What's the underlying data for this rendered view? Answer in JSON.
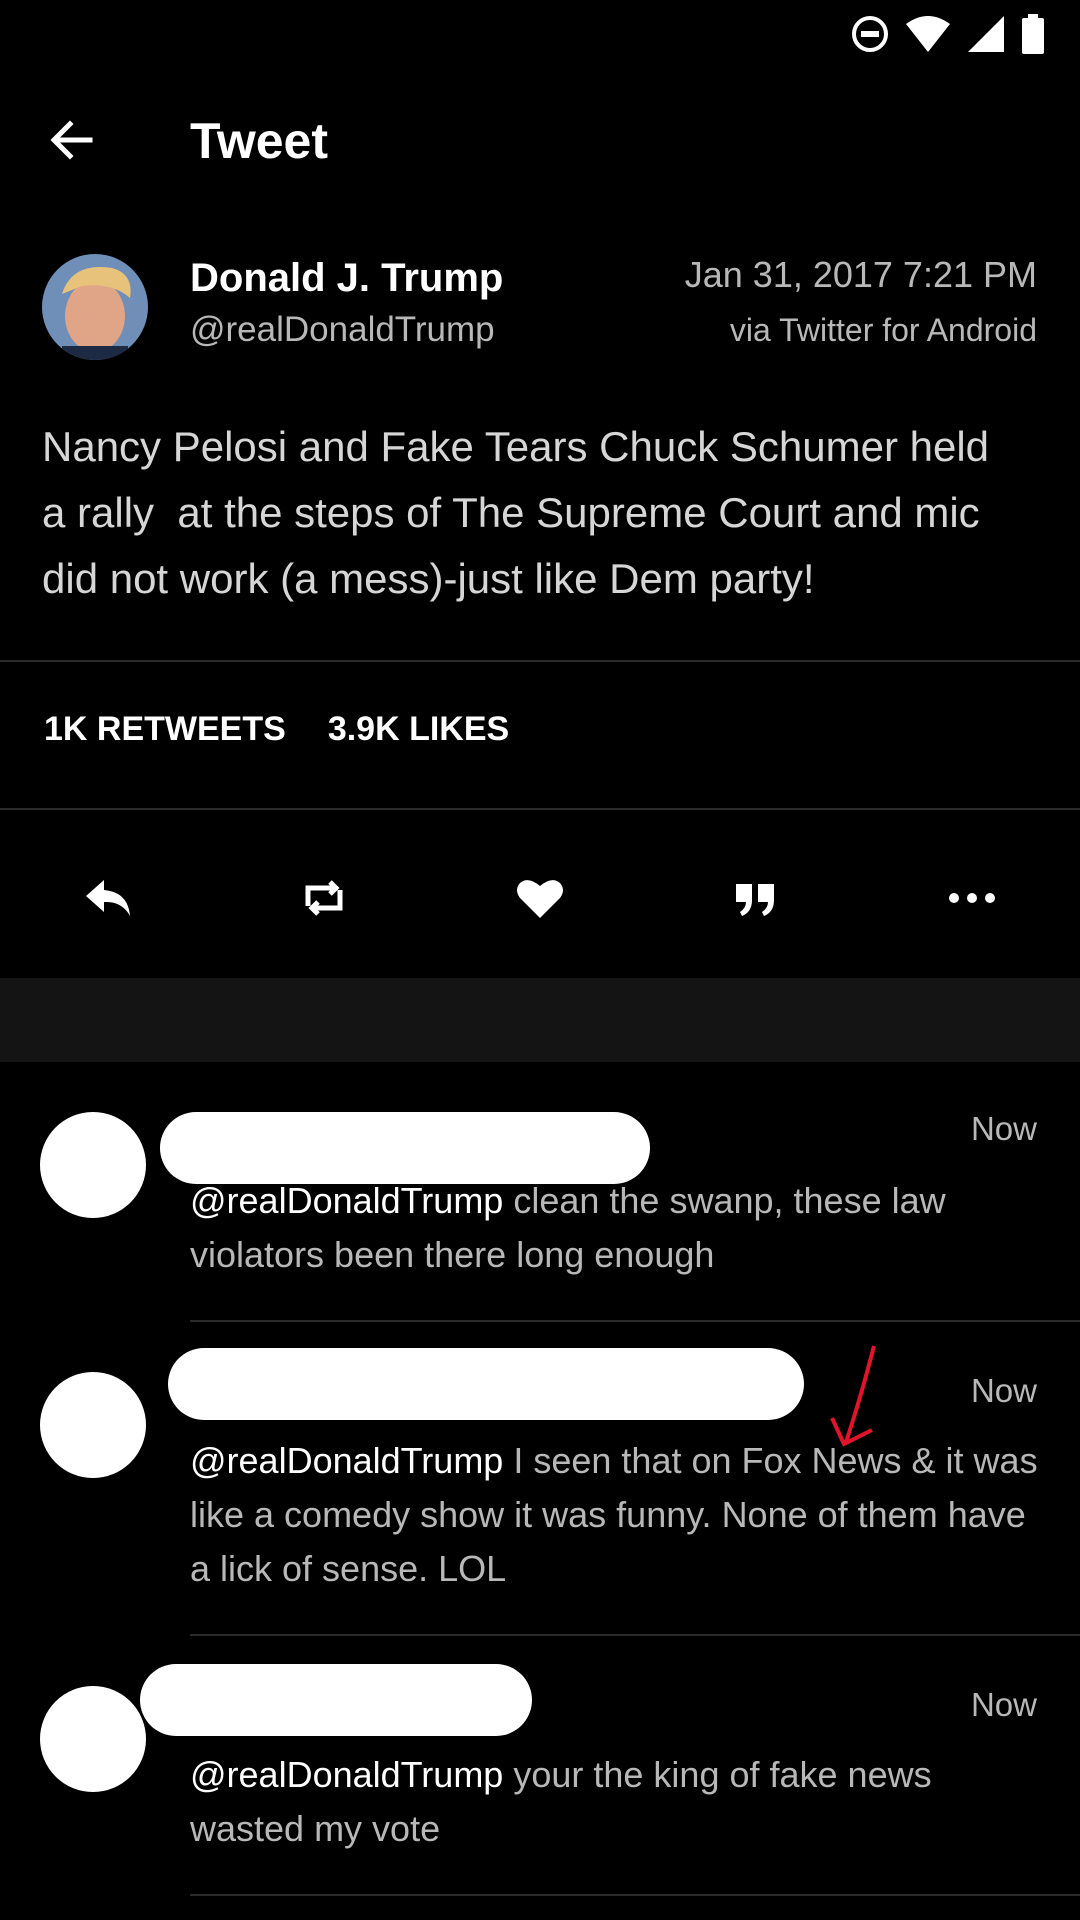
{
  "app_bar": {
    "title": "Tweet",
    "back_icon": "arrow-left-icon"
  },
  "status_bar": {
    "icons": [
      "do-not-disturb-icon",
      "wifi-icon",
      "signal-icon",
      "battery-icon"
    ]
  },
  "tweet": {
    "author_name": "Donald J. Trump",
    "author_handle": "@realDonaldTrump",
    "timestamp": "Jan 31, 2017 7:21 PM",
    "source": "via Twitter for Android",
    "text": "Nancy Pelosi and Fake Tears Chuck Schumer held\na rally  at the steps of The Supreme Court and mic\ndid not work (a mess)-just like Dem party!",
    "retweets_label": "1K RETWEETS",
    "likes_label": "3.9K LIKES"
  },
  "actions": [
    "reply-icon",
    "retweet-icon",
    "heart-icon",
    "quote-icon",
    "more-icon"
  ],
  "replies": [
    {
      "time": "Now",
      "mention": "@realDonaldTrump",
      "text": " clean the swanp, these law violators been there long enough"
    },
    {
      "time": "Now",
      "mention": "@realDonaldTrump",
      "text": " I seen that on Fox News & it was like a comedy show it was funny. None of them have a lick of sense. LOL"
    },
    {
      "time": "Now",
      "mention": "@realDonaldTrump",
      "text": " your the king of fake news wasted my vote"
    }
  ],
  "colors": {
    "background": "#000000",
    "secondary_text": "#b8b8b8",
    "divider": "#2a2a2a",
    "annotation_arrow": "#e0142a"
  }
}
